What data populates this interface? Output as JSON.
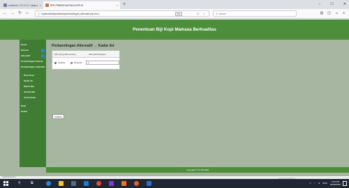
{
  "browser": {
    "tabs": [
      {
        "label": "localhost / 127.0.0.1 / skripsi"
      },
      {
        "label": "SPK PENENTUAN BIJI KOPI M"
      }
    ],
    "new_tab": "+",
    "url": "localhost/skripsi/admin/perbandingan_alternatif.php?id=1",
    "zoom": "70%",
    "address_actions": "··· ☐ ☆",
    "search_placeholder": "Search",
    "status_text": "localhost/skripsi/..."
  },
  "app": {
    "header_title": "Penentuan Biji Kopi Mamasa Berkualitas",
    "footer": "Copyright © 27-06-2020"
  },
  "sidebar": {
    "items": [
      {
        "label": "Home"
      },
      {
        "label": "Kriteria"
      },
      {
        "label": "Alternatif"
      },
      {
        "label": "Perbandingan Kriteria"
      },
      {
        "label": "Perbandingan Alternatif"
      },
      {
        "label": "Rasa Kopi"
      },
      {
        "label": "Kadar Air"
      },
      {
        "label": "Warna Biji"
      },
      {
        "label": "Ukuran Biji"
      },
      {
        "label": "Aroma Kopi"
      },
      {
        "label": "Hasil"
      },
      {
        "label": "Keluar"
      }
    ]
  },
  "main": {
    "title": "Perbandingan Alternatif → Kadar Air",
    "table": {
      "headers": [
        "pilih yang lebih penting",
        "nilai perbandingan"
      ],
      "options": [
        "Arabika",
        "Robusta"
      ],
      "value": "1"
    },
    "submit_label": "SUBMIT"
  },
  "watermark": {
    "line1": "Activate Windows",
    "line2": "Go to Settings to activate Windows."
  },
  "taskbar": {
    "lang": "ENG",
    "time": "2:03 PM",
    "date": "25/06/2020"
  }
}
